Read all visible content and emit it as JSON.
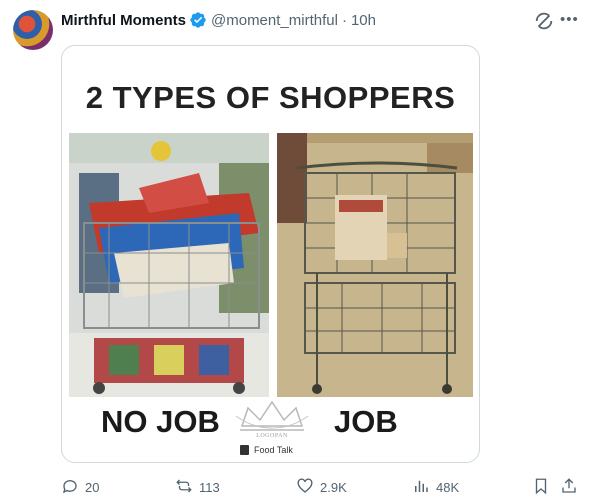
{
  "author": {
    "name": "Mirthful Moments",
    "handle": "@moment_mirthful",
    "separator": "·",
    "time": "10h",
    "verified": true
  },
  "media": {
    "title": "2 TYPES OF SHOPPERS",
    "left_caption": "NO JOB",
    "right_caption": "JOB",
    "watermark_label": "Food Talk",
    "watermark_logo_text": "LOGOPAN"
  },
  "actions": {
    "replies": "20",
    "reposts": "113",
    "likes": "2.9K",
    "views": "48K"
  },
  "colors": {
    "muted": "#536471",
    "verified": "#1d9bf0",
    "border": "#cfd9de"
  },
  "icons": {
    "grok": "grok-icon",
    "more": "more-icon",
    "reply": "reply-icon",
    "repost": "repost-icon",
    "like": "heart-icon",
    "views": "views-icon",
    "bookmark": "bookmark-icon",
    "share": "share-icon"
  }
}
